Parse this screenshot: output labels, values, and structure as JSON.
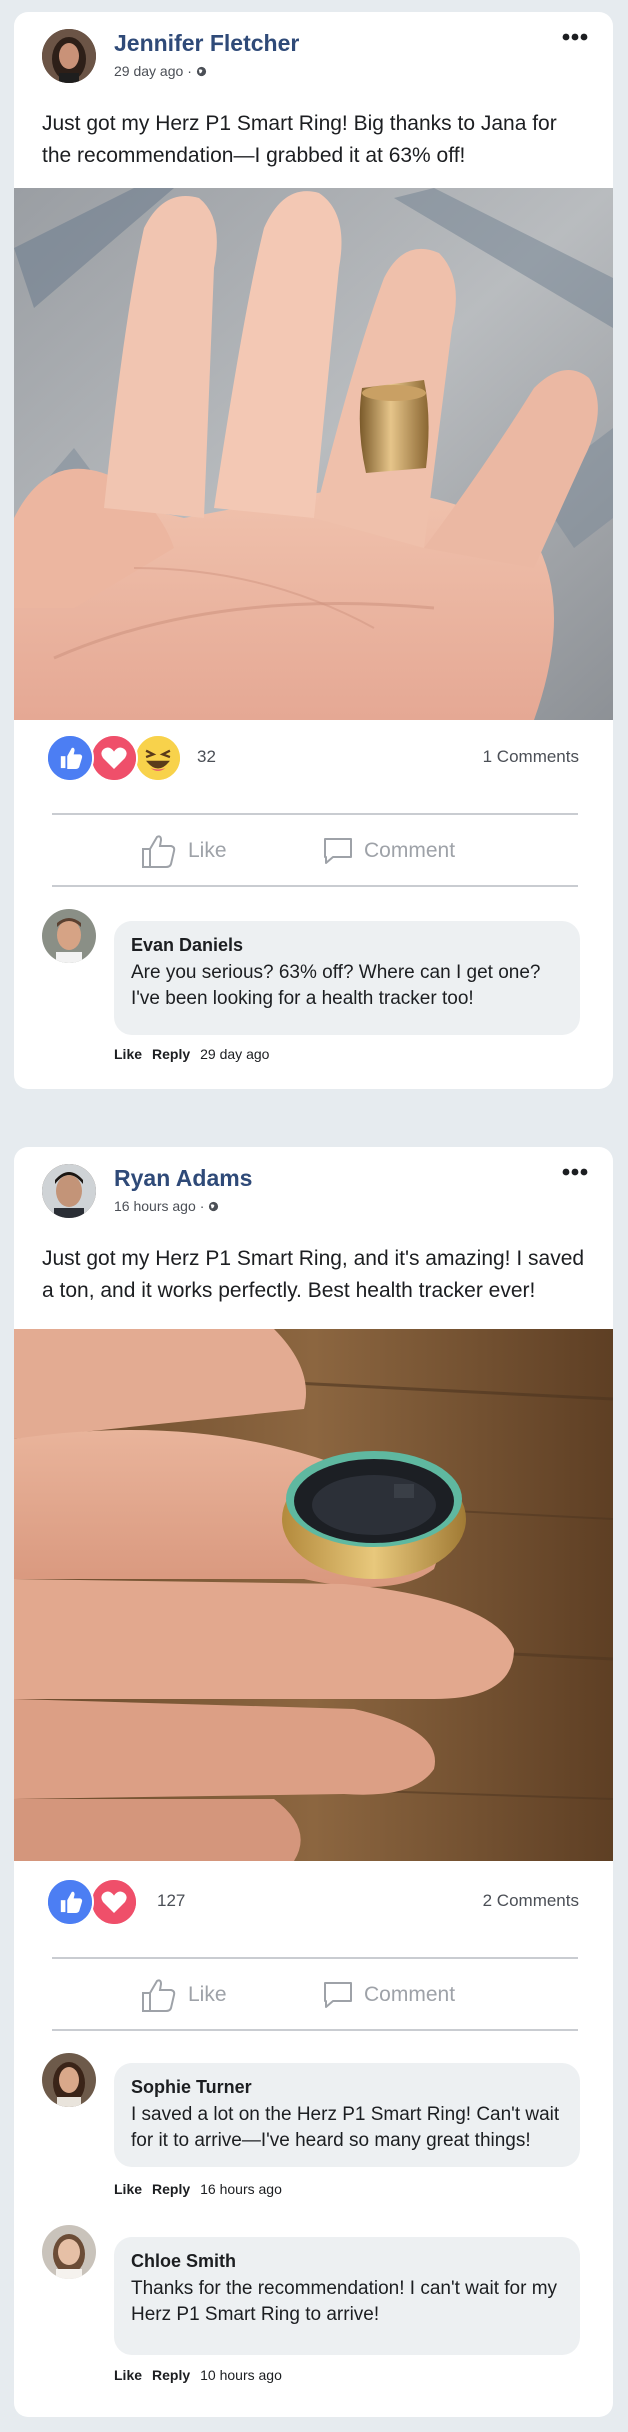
{
  "posts": [
    {
      "author": "Jennifer Fletcher",
      "time": "29 day ago",
      "separator": "·",
      "text": "Just got my Herz P1 Smart Ring! Big thanks to Jana for the recommendation—I grabbed it at 63% off!",
      "photo": "hand-with-gold-smart-ring-on-finger",
      "reactions": [
        "like-icon",
        "love-icon",
        "haha-icon"
      ],
      "reaction_count": "32",
      "comments_count": "1 Comments",
      "like_label": "Like",
      "comment_label": "Comment",
      "comments": [
        {
          "author": "Evan Daniels",
          "text": "Are you serious? 63% off? Where can I get one? I've been looking for a health tracker too!",
          "like": "Like",
          "reply": "Reply",
          "time": "29 day ago"
        }
      ]
    },
    {
      "author": "Ryan Adams",
      "time": "16 hours ago",
      "separator": "·",
      "text": "Just got my Herz P1 Smart Ring, and it's amazing! I saved a ton, and it works perfectly. Best health tracker ever!",
      "photo": "fingers-holding-gold-smart-ring",
      "reactions": [
        "like-icon",
        "love-icon"
      ],
      "reaction_count": "127",
      "comments_count": "2 Comments",
      "like_label": "Like",
      "comment_label": "Comment",
      "comments": [
        {
          "author": "Sophie Turner",
          "text": "I saved a lot on the Herz P1 Smart Ring! Can't wait for it to arrive—I've heard so many great things!",
          "like": "Like",
          "reply": "Reply",
          "time": "16 hours ago"
        },
        {
          "author": "Chloe Smith",
          "text": "Thanks for the recommendation! I can't wait for my Herz P1 Smart Ring to arrive!",
          "like": "Like",
          "reply": "Reply",
          "time": "10 hours ago"
        }
      ]
    }
  ],
  "colors": {
    "page_bg": "#e6ebef",
    "author": "#2f4a78",
    "like_blue": "#4c7ef3",
    "love_red": "#ef4f6a",
    "haha_yellow": "#f8d24b",
    "bubble": "#edf0f2"
  }
}
